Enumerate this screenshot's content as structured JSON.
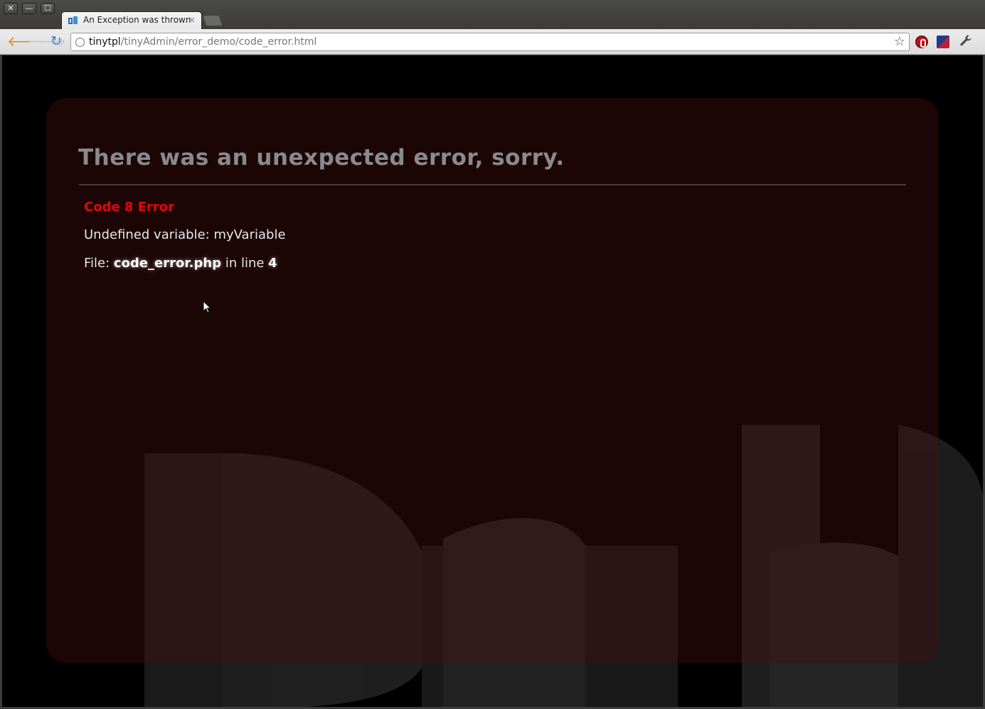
{
  "window": {
    "buttons": {
      "close": "✕",
      "minimize": "—",
      "maximize": "☐"
    }
  },
  "tab": {
    "title": "An Exception was thrown",
    "close": "×",
    "favicon": "page-favicon-icon"
  },
  "toolbar": {
    "back_icon": "🡐",
    "forward_icon": "🡒",
    "reload_icon": "↻",
    "url_host": "tinytpl",
    "url_path": "/tinyAdmin/error_demo/code_error.html",
    "star_icon": "☆",
    "menu_icon": "🔧"
  },
  "page": {
    "heading": "There was an unexpected error, sorry.",
    "error_code": "Code 8 Error",
    "error_message": "Undefined variable: myVariable",
    "file_prefix": "File: ",
    "file_name": "code_error.php",
    "line_prefix": " in line ",
    "line_number": "4"
  },
  "colors": {
    "error_red": "#ee0000",
    "heading_gray": "#8a8a8a",
    "panel": "#2a0c0c"
  }
}
